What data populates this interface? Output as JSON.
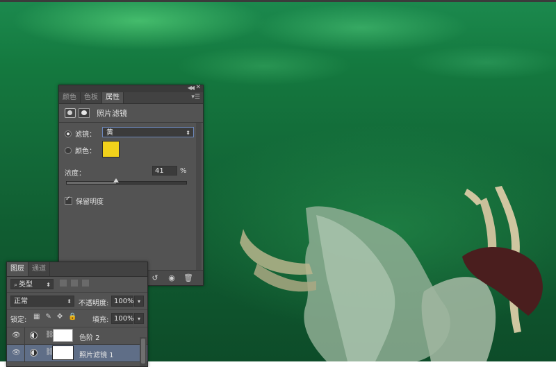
{
  "properties_panel": {
    "tabs": [
      {
        "label": "颜色",
        "active": false
      },
      {
        "label": "色板",
        "active": false
      },
      {
        "label": "属性",
        "active": true
      }
    ],
    "title": "照片滤镜",
    "filter": {
      "label": "滤镜：",
      "value": "黄",
      "selected": true
    },
    "color": {
      "label": "颜色：",
      "value": "#f2d21b",
      "selected": false
    },
    "density": {
      "label": "浓度：",
      "value": "41",
      "unit": "%",
      "fraction": 0.41
    },
    "preserve_luminosity": {
      "label": "保留明度",
      "checked": true
    }
  },
  "layers_panel": {
    "tabs": [
      {
        "label": "图层",
        "active": true
      },
      {
        "label": "通道",
        "active": false
      }
    ],
    "kind_filter": {
      "value": "类型"
    },
    "blend_mode": {
      "value": "正常"
    },
    "opacity": {
      "label": "不透明度:",
      "value": "100%"
    },
    "lock": {
      "label": "锁定:"
    },
    "fill": {
      "label": "填充:",
      "value": "100%"
    },
    "layers": [
      {
        "name": "色阶 2",
        "visible": true,
        "selected": false
      },
      {
        "name": "照片滤镜 1",
        "visible": true,
        "selected": true
      }
    ]
  },
  "colors": {
    "panel_bg": "#535353",
    "selection": "#5f6e87",
    "swatch_yellow": "#f2d21b"
  }
}
